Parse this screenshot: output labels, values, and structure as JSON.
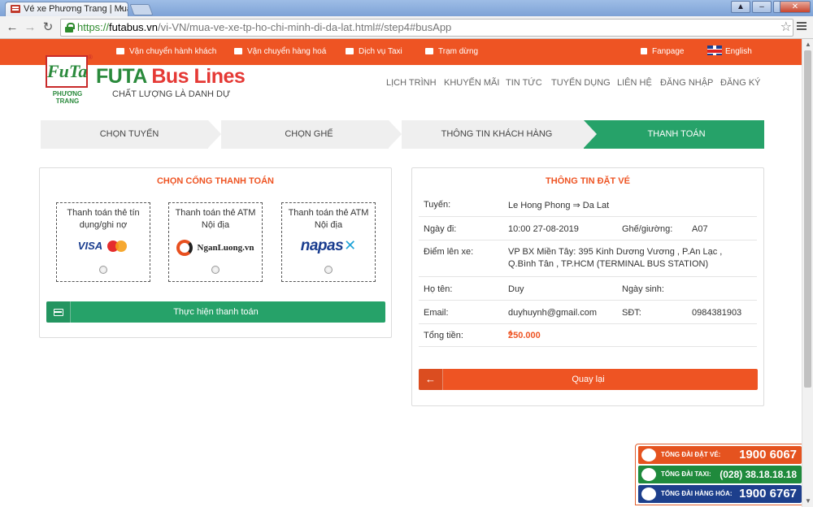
{
  "browser": {
    "tab_title": "Vé xe Phương Trang | Mua v",
    "tab_close": "×",
    "url_proto": "https://",
    "url_host": "futabus.vn",
    "url_path": "/vi-VN/mua-ve-xe-tp-ho-chi-minh-di-da-lat.html#/step4#busApp",
    "back": "←",
    "forward": "→",
    "reload": "↻",
    "star": "☆",
    "win_min": "–",
    "win_max": "□",
    "win_close": "✕",
    "win_user": "▲"
  },
  "topbar": {
    "links": [
      "Vận chuyển hành khách",
      "Vận chuyển hàng hoá",
      "Dịch vụ Taxi",
      "Trạm dừng"
    ],
    "fanpage": "Fanpage",
    "language": "English"
  },
  "brand": {
    "emblem": "FuTa",
    "reg": "®",
    "emblem_sub": "PHƯƠNG TRANG",
    "name_part1": "FUTA",
    "name_part2": "Bus Lines",
    "slogan": "CHẤT LƯỢNG LÀ DANH DỰ"
  },
  "nav": {
    "items": [
      "LỊCH TRÌNH",
      "KHUYẾN MÃI",
      "TIN TỨC",
      "TUYỂN DỤNG",
      "LIÊN HỆ",
      "ĐĂNG NHẬP",
      "ĐĂNG KÝ"
    ]
  },
  "steps": [
    "CHỌN TUYẾN",
    "CHỌN GHẾ",
    "THÔNG TIN KHÁCH HÀNG",
    "THANH TOÁN"
  ],
  "payment": {
    "title": "CHỌN CỔNG THANH TOÁN",
    "options": [
      {
        "label_line1": "Thanh toán thẻ tín",
        "label_line2": "dụng/ghi nợ",
        "logo_text": "VISA"
      },
      {
        "label_line1": "Thanh toán thẻ ATM",
        "label_line2": "Nội địa",
        "logo_text": "NganLuong.vn"
      },
      {
        "label_line1": "Thanh toán thẻ ATM",
        "label_line2": "Nội địa",
        "logo_text": "napas"
      }
    ],
    "submit": "Thực hiện thanh toán"
  },
  "booking": {
    "title": "THÔNG TIN ĐẶT VÉ",
    "route_label": "Tuyến:",
    "route_value": "Le Hong Phong ⇒ Da Lat",
    "date_label": "Ngày đi:",
    "date_value": "10:00 27-08-2019",
    "seat_label": "Ghế/giường:",
    "seat_value": "A07",
    "pickup_label": "Điểm lên xe:",
    "pickup_line1": "VP BX Miền Tây: 395 Kinh Dương Vương , P.An Lạc ,",
    "pickup_line2": "Q.Bình Tân , TP.HCM (TERMINAL BUS STATION)",
    "name_label": "Họ tên:",
    "name_value": "Duy",
    "dob_label": "Ngày sinh:",
    "dob_value": "",
    "email_label": "Email:",
    "email_value": "duyhuynh@gmail.com",
    "phone_label": "SĐT:",
    "phone_value": "0984381903",
    "total_label": "Tổng tiền:",
    "total_value": "250.000",
    "currency": "đ",
    "back_button": "Quay lại"
  },
  "hotline": [
    {
      "label": "TỔNG ĐÀI ĐẶT VÉ:",
      "number": "1900 6067",
      "color": "#e5531f"
    },
    {
      "label": "TỔNG ĐÀI TAXI:",
      "number": "(028) 38.18.18.18",
      "color": "#1f8a3c"
    },
    {
      "label": "TỔNG ĐÀI HÀNG HÓA:",
      "number": "1900 6767",
      "color": "#1d3f8c"
    }
  ],
  "colors": {
    "accent_orange": "#ee5423",
    "accent_green": "#26a269"
  }
}
